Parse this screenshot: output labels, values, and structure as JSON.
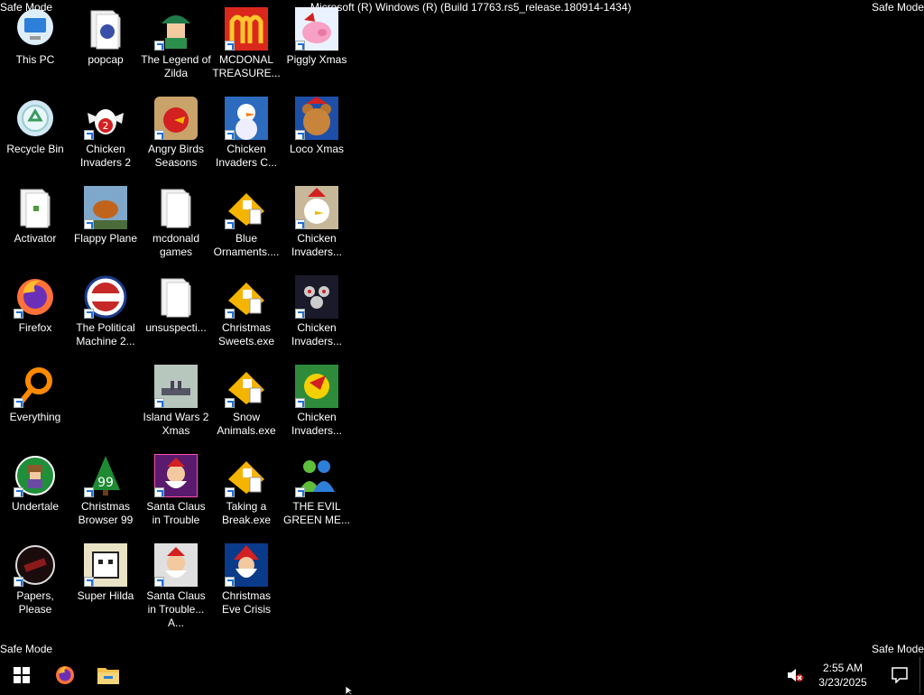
{
  "watermarks": {
    "top_left": "Safe Mode",
    "top_right": "Safe Mode",
    "bottom_left": "Safe Mode",
    "bottom_right": "Safe Mode",
    "build": "Microsoft (R) Windows (R) (Build 17763.rs5_release.180914-1434)"
  },
  "desktop_icons": [
    {
      "label": "This PC",
      "icon": "this-pc-icon"
    },
    {
      "label": "Recycle Bin",
      "icon": "recycle-bin-icon"
    },
    {
      "label": "Activator",
      "icon": "folder-icon"
    },
    {
      "label": "Firefox",
      "icon": "firefox-icon"
    },
    {
      "label": "Everything",
      "icon": "everything-search-icon"
    },
    {
      "label": "Undertale",
      "icon": "undertale-icon"
    },
    {
      "label": "Papers, Please",
      "icon": "papers-please-icon"
    },
    {
      "label": "popcap",
      "icon": "folder-icon"
    },
    {
      "label": "Chicken Invaders 2",
      "icon": "chicken-invaders-2-icon"
    },
    {
      "label": "Flappy Plane",
      "icon": "flappy-plane-icon"
    },
    {
      "label": "The Political Machine 2...",
      "icon": "political-machine-icon"
    },
    {
      "label": "Christmas Browser 99",
      "icon": "christmas-browser-icon"
    },
    {
      "label": "Super Hilda",
      "icon": "super-hilda-icon"
    },
    {
      "label": "The Legend of Zilda",
      "icon": "legend-of-zilda-icon"
    },
    {
      "label": "Angry Birds Seasons",
      "icon": "angry-birds-icon"
    },
    {
      "label": "mcdonald games",
      "icon": "folder-icon"
    },
    {
      "label": "unsuspecti...",
      "icon": "folder-icon"
    },
    {
      "label": "Island Wars 2 Xmas",
      "icon": "island-wars-icon"
    },
    {
      "label": "Santa Claus in Trouble",
      "icon": "santa-claus-icon"
    },
    {
      "label": "Santa Claus in Trouble... A...",
      "icon": "santa-claus-icon"
    },
    {
      "label": "MCDONAL TREASURE...",
      "icon": "mcdonalds-icon"
    },
    {
      "label": "Chicken Invaders C...",
      "icon": "snowman-icon"
    },
    {
      "label": "Blue Ornaments....",
      "icon": "exe-icon"
    },
    {
      "label": "Christmas Sweets.exe",
      "icon": "exe-icon"
    },
    {
      "label": "Snow Animals.exe",
      "icon": "exe-icon"
    },
    {
      "label": "Taking a Break.exe",
      "icon": "exe-icon"
    },
    {
      "label": "Christmas Eve Crisis",
      "icon": "santa-icon"
    },
    {
      "label": "Piggly Xmas",
      "icon": "piggly-icon"
    },
    {
      "label": "Loco Xmas",
      "icon": "teddy-bear-icon"
    },
    {
      "label": "Chicken Invaders...",
      "icon": "chicken-invaders-icon"
    },
    {
      "label": "Chicken Invaders...",
      "icon": "chicken-invaders-icon"
    },
    {
      "label": "Chicken Invaders...",
      "icon": "chicken-invaders-icon"
    },
    {
      "label": "THE EVIL GREEN ME...",
      "icon": "messenger-icon"
    }
  ],
  "taskbar": {
    "start": "windows-start-icon",
    "pinned": [
      "firefox-icon",
      "file-explorer-icon"
    ],
    "tray": {
      "volume": "volume-muted-icon",
      "time": "2:55 AM",
      "date": "3/23/2025",
      "notifications": "action-center-icon"
    }
  },
  "colors": {
    "background": "#000000",
    "text": "#ffffff",
    "shortcut_arrow": "#1e6fd9"
  }
}
